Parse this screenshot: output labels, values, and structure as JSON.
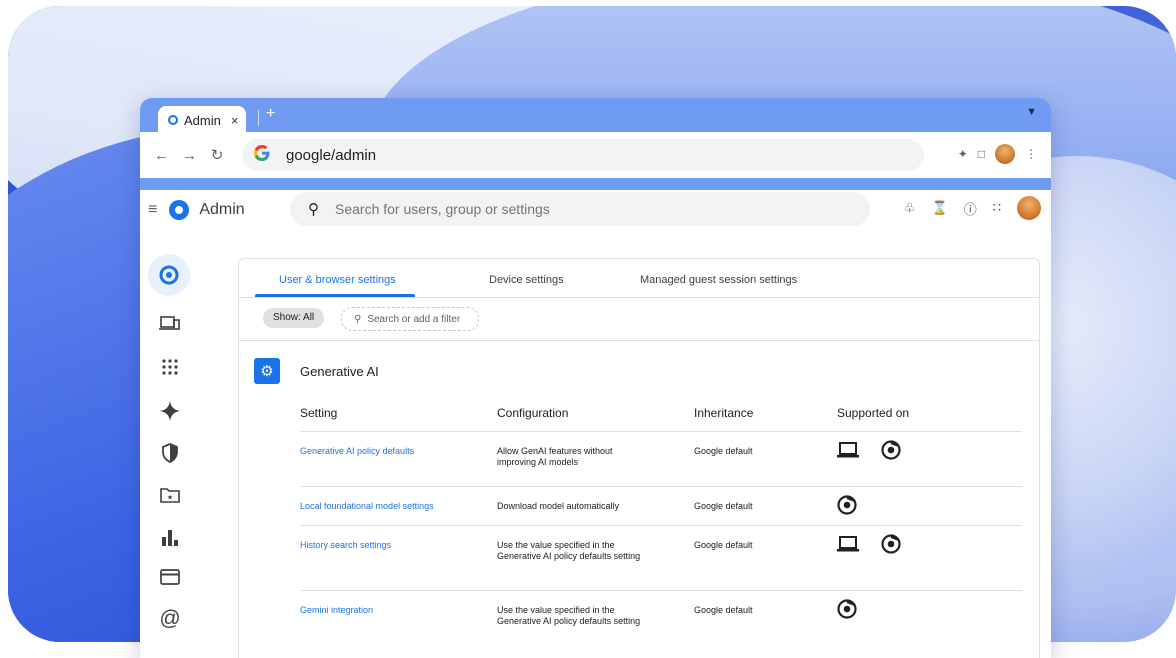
{
  "browser": {
    "tab_title": "Admin",
    "tab_close": "×",
    "new_tab": "+",
    "url": "google/admin"
  },
  "app": {
    "title": "Admin",
    "search_placeholder": "Search for users, group or settings"
  },
  "tabs": [
    {
      "label": "User & browser settings",
      "active": true
    },
    {
      "label": "Device settings",
      "active": false
    },
    {
      "label": "Managed guest session settings",
      "active": false
    }
  ],
  "filter": {
    "show_chip": "Show: All",
    "placeholder": "Search or add a filter"
  },
  "section": {
    "title": "Generative AI",
    "columns": [
      "Setting",
      "Configuration",
      "Inheritance",
      "Supported on"
    ],
    "rows": [
      {
        "setting": "Generative AI policy defaults",
        "config": "Allow GenAI features without improving AI models",
        "inheritance": "Google default",
        "supported": [
          "laptop-icon",
          "chrome-icon"
        ]
      },
      {
        "setting": "Local foundational model settings",
        "config": "Download model automatically",
        "inheritance": "Google default",
        "supported": [
          "chrome-icon"
        ]
      },
      {
        "setting": "History search settings",
        "config": "Use the value specified in the Generative AI policy defaults setting",
        "inheritance": "Google default",
        "supported": [
          "laptop-icon",
          "chrome-icon"
        ]
      },
      {
        "setting": "Gemini integration",
        "config": "Use the value specified in the Generative AI policy defaults setting",
        "inheritance": "Google default",
        "supported": [
          "chrome-icon"
        ]
      }
    ]
  },
  "colors": {
    "accent": "#1a73e8",
    "tabstrip": "#6f9bf2"
  }
}
